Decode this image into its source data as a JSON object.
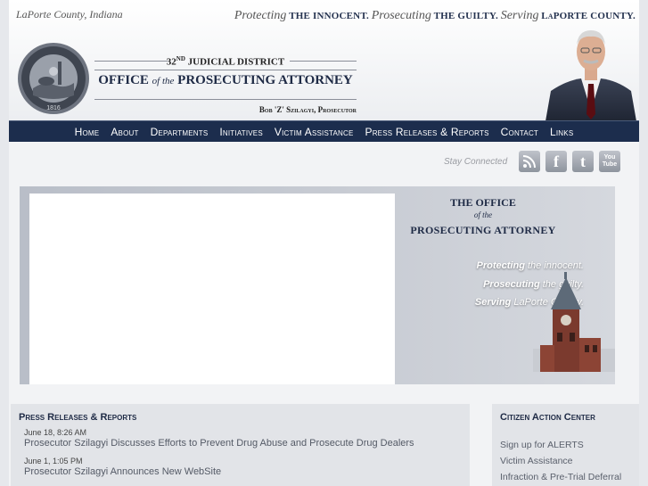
{
  "header": {
    "county": "LaPorte County, Indiana",
    "tagline": {
      "w1": "Protecting",
      "p1": "THE INNOCENT.",
      "w2": "Prosecuting",
      "p2": "THE GUILTY.",
      "w3": "Serving",
      "p3": "LaPORTE COUNTY."
    },
    "seal_text": "SEAL OF THE STATE OF INDIANA",
    "seal_year": "1816",
    "district_prefix": "32",
    "district_sup": "ND",
    "district_rest": " JUDICIAL DISTRICT",
    "office_a": "OFFICE ",
    "office_of": "of the",
    "office_b": " PROSECUTING ATTORNEY",
    "prosecutor": "Bob 'Z' Szilagyi, Prosecutor"
  },
  "nav": [
    "Home",
    "About",
    "Departments",
    "Initiatives",
    "Victim Assistance",
    "Press Releases & Reports",
    "Contact",
    "Links"
  ],
  "social": {
    "stay_connected": "Stay Connected",
    "icons": [
      "rss-icon",
      "facebook-icon",
      "twitter-icon",
      "youtube-icon"
    ],
    "facebook_glyph": "f",
    "twitter_glyph": "t",
    "youtube_glyph_1": "You",
    "youtube_glyph_2": "Tube"
  },
  "banner": {
    "title_1": "THE OFFICE",
    "title_of": "of the",
    "title_2": "PROSECUTING ATTORNEY",
    "line1_a": "Protecting",
    "line1_b": " the innocent.",
    "line2_a": "Prosecuting",
    "line2_b": " the guilty.",
    "line3_a": "Serving",
    "line3_b": " LaPorte County."
  },
  "press": {
    "title": "Press Releases & Reports",
    "items": [
      {
        "date": "June 18, 8:26 AM",
        "text": "Prosecutor Szilagyi Discusses Efforts to Prevent Drug Abuse and Prosecute Drug Dealers"
      },
      {
        "date": "June 1, 1:05 PM",
        "text": "Prosecutor Szilagyi Announces New WebSite"
      }
    ]
  },
  "citizen": {
    "title": "Citizen Action Center",
    "links": [
      "Sign up for ALERTS",
      "Victim Assistance",
      "Infraction & Pre-Trial Deferral"
    ]
  },
  "colors": {
    "navy": "#1c2d4d",
    "panel": "#e2e4e8"
  }
}
